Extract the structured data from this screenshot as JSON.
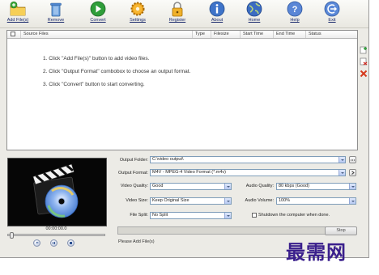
{
  "toolbar": {
    "items": [
      {
        "label": "Add File(s)",
        "icon": "add-files-icon"
      },
      {
        "label": "Remove",
        "icon": "trash-icon"
      },
      {
        "label": "Convert",
        "icon": "convert-play-icon"
      },
      {
        "label": "Settings",
        "icon": "gear-icon"
      },
      {
        "label": "Register",
        "icon": "lock-icon"
      },
      {
        "label": "About",
        "icon": "info-icon"
      },
      {
        "label": "Home",
        "icon": "home-globe-icon"
      },
      {
        "label": "Help",
        "icon": "help-icon"
      },
      {
        "label": "Exit",
        "icon": "exit-icon"
      }
    ]
  },
  "file_list": {
    "columns": [
      "Source Files",
      "Type",
      "Filesize",
      "Start Time",
      "End Time",
      "Status"
    ],
    "instructions": [
      "1. Click \"Add File(s)\" button to add video files.",
      "2. Click \"Output Format\" combobox to choose an output format.",
      "3. Click \"Convert\" button to start converting."
    ]
  },
  "player": {
    "time": "00:00:00.0"
  },
  "settings": {
    "output_folder_label": "Output Folder:",
    "output_folder_value": "C:\\video output\\",
    "output_format_label": "Output Format:",
    "output_format_value": "M4V - MPEG-4 Video Format (*.m4v)",
    "video_quality_label": "Video Quality:",
    "video_quality_value": "Good",
    "audio_quality_label": "Audio Quality:",
    "audio_quality_value": "80 kbps (Good)",
    "video_size_label": "Video Size:",
    "video_size_value": "Keep Original Size",
    "audio_volume_label": "Audio Volume:",
    "audio_volume_value": "100%",
    "file_split_label": "File Split:",
    "file_split_value": "No Split",
    "shutdown_label": "Shutdown the computer when done."
  },
  "progress": {
    "stop_label": "Stop",
    "status_text": "Please Add File(s)",
    "percent": 0
  },
  "watermark": {
    "text": "最需网"
  },
  "colors": {
    "link_blue": "#1a2a6c",
    "watermark": "#3a1f8c"
  }
}
